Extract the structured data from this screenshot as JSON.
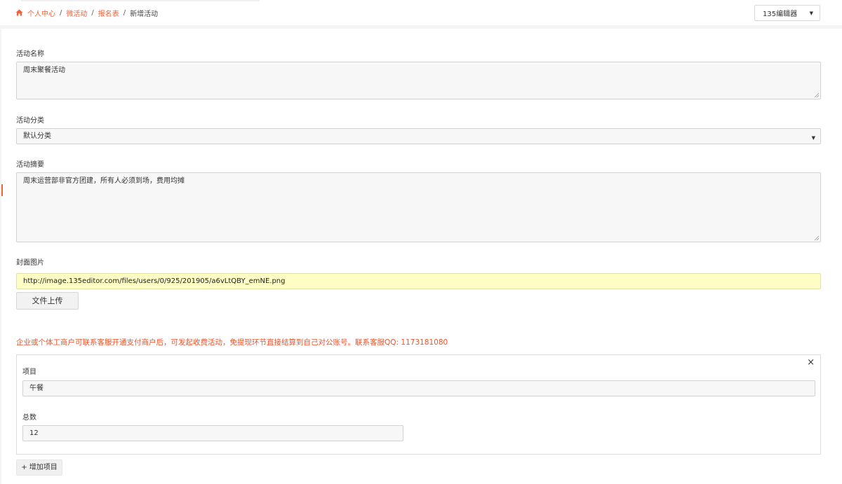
{
  "breadcrumb": {
    "home_icon": "home-icon",
    "items": [
      "个人中心",
      "微活动",
      "报名表"
    ],
    "current": "新增活动",
    "separator": "/"
  },
  "editor_select": {
    "value": "135编辑器",
    "caret_icon": "caret-down-icon"
  },
  "form": {
    "name": {
      "label": "活动名称",
      "value": "周末聚餐活动"
    },
    "category": {
      "label": "活动分类",
      "value": "默认分类"
    },
    "summary": {
      "label": "活动摘要",
      "value": "周末运营部非官方团建，所有人必须到场，费用均摊"
    },
    "cover": {
      "label": "封面图片",
      "value": "http://image.135editor.com/files/users/0/925/201905/a6vLtQBY_emNE.png",
      "upload_label": "文件上传"
    },
    "notice": "企业或个体工商户可联系客服开通支付商户后，可发起收费活动，免提现环节直接结算到自己对公账号。联系客服QQ: 1173181080",
    "item": {
      "close_label": "×",
      "project_label": "项目",
      "project_value": "午餐",
      "total_label": "总数",
      "total_value": "12"
    },
    "add_item_label": "+ 增加项目"
  },
  "colors": {
    "accent": "#f0623a",
    "notice": "#f0522a",
    "url_bg": "#fdfdc4"
  }
}
